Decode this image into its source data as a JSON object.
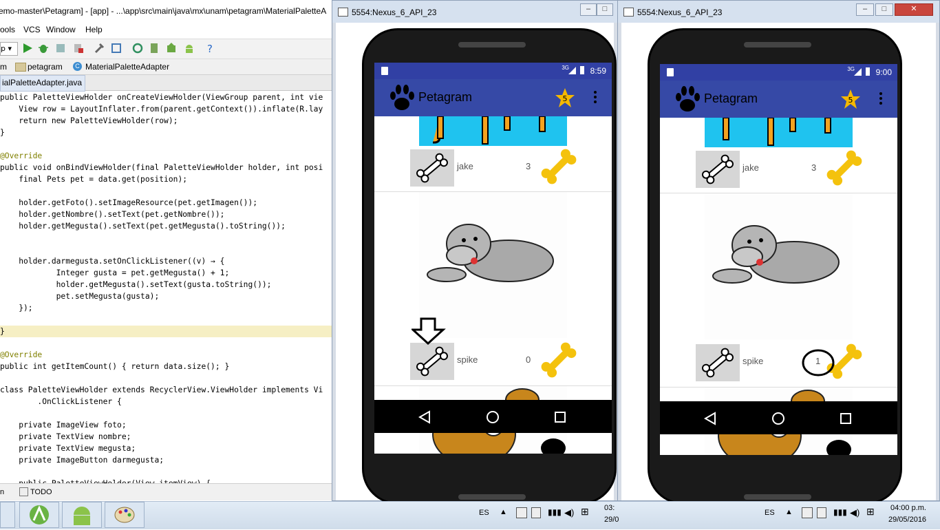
{
  "ide": {
    "title": "emo-master\\Petagram] - [app] - ...\\app\\src\\main\\java\\mx\\unam\\petagram\\MaterialPaletteA",
    "menu": [
      "ools",
      "VCS",
      "Window",
      "Help"
    ],
    "toolbar_dropdown": "p",
    "breadcrumb": [
      "m",
      "petagram",
      "MaterialPaletteAdapter"
    ],
    "file_tab": "ialPaletteAdapter.java",
    "code": [
      "public PaletteViewHolder onCreateViewHolder(ViewGroup parent, int vie",
      "    View row = LayoutInflater.from(parent.getContext()).inflate(R.lay",
      "    return new PaletteViewHolder(row);",
      "}",
      "",
      "@Override",
      "public void onBindViewHolder(final PaletteViewHolder holder, int posi",
      "    final Pets pet = data.get(position);",
      "",
      "    holder.getFoto().setImageResource(pet.getImagen());",
      "    holder.getNombre().setText(pet.getNombre());",
      "    holder.getMegusta().setText(pet.getMegusta().toString());",
      "",
      "",
      "    holder.darmegusta.setOnClickListener((v) → {",
      "            Integer gusta = pet.getMegusta() + 1;",
      "            holder.getMegusta().setText(gusta.toString());",
      "            pet.setMegusta(gusta);",
      "    });",
      "",
      "}",
      "",
      "@Override",
      "public int getItemCount() { return data.size(); }",
      "",
      "class PaletteViewHolder extends RecyclerView.ViewHolder implements Vi",
      "        .OnClickListener {",
      "",
      "    private ImageView foto;",
      "    private TextView nombre;",
      "    private TextView megusta;",
      "    private ImageButton darmegusta;",
      "",
      "    public PaletteViewHolder(View itemView) {"
    ],
    "bottom_tabs": [
      "n",
      "TODO"
    ]
  },
  "emulator_left": {
    "title": "5554:Nexus_6_API_23",
    "status_time": "8:59",
    "network": "3G",
    "app_title": "Petagram",
    "star_count": "5",
    "pets": [
      {
        "name": "jake",
        "likes": "3"
      },
      {
        "name": "spike",
        "likes": "0"
      }
    ]
  },
  "emulator_right": {
    "title": "5554:Nexus_6_API_23",
    "status_time": "9:00",
    "network": "3G",
    "app_title": "Petagram",
    "star_count": "5",
    "pets": [
      {
        "name": "jake",
        "likes": "3"
      },
      {
        "name": "spike",
        "likes": "1"
      }
    ]
  },
  "taskbar": {
    "lang": "ES",
    "lang2": "ES",
    "time_left": "03:",
    "date_left": "29/0",
    "time_right": "04:00 p.m.",
    "date_right": "29/05/2016"
  },
  "colors": {
    "appbar": "#3649a6",
    "statusbar": "#3140a4",
    "bone_yellow": "#f4c20d",
    "star_yellow": "#f5b800"
  }
}
